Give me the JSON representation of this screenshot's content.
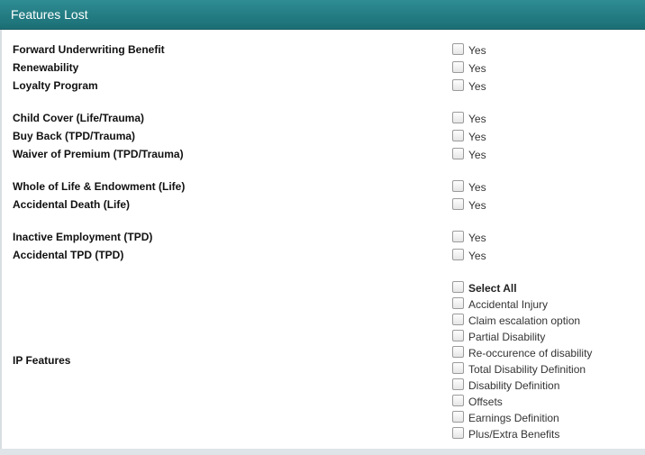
{
  "panel": {
    "title": "Features Lost"
  },
  "features": [
    {
      "label": "Forward Underwriting Benefit",
      "option": "Yes",
      "checked": false
    },
    {
      "label": "Renewability",
      "option": "Yes",
      "checked": false
    },
    {
      "label": "Loyalty Program",
      "option": "Yes",
      "checked": false
    },
    {
      "label": "Child Cover (Life/Trauma)",
      "option": "Yes",
      "checked": false
    },
    {
      "label": "Buy Back (TPD/Trauma)",
      "option": "Yes",
      "checked": false
    },
    {
      "label": "Waiver of Premium (TPD/Trauma)",
      "option": "Yes",
      "checked": false
    },
    {
      "label": "Whole of Life & Endowment (Life)",
      "option": "Yes",
      "checked": false
    },
    {
      "label": "Accidental Death (Life)",
      "option": "Yes",
      "checked": false
    },
    {
      "label": "Inactive Employment (TPD)",
      "option": "Yes",
      "checked": false
    },
    {
      "label": "Accidental TPD (TPD)",
      "option": "Yes",
      "checked": false
    }
  ],
  "ip_features": {
    "label": "IP Features",
    "select_all": "Select All",
    "options": [
      "Accidental Injury",
      "Claim escalation option",
      "Partial Disability",
      "Re-occurence of disability",
      "Total Disability Definition",
      "Disability Definition",
      "Offsets",
      "Earnings Definition",
      "Plus/Extra Benefits"
    ]
  }
}
